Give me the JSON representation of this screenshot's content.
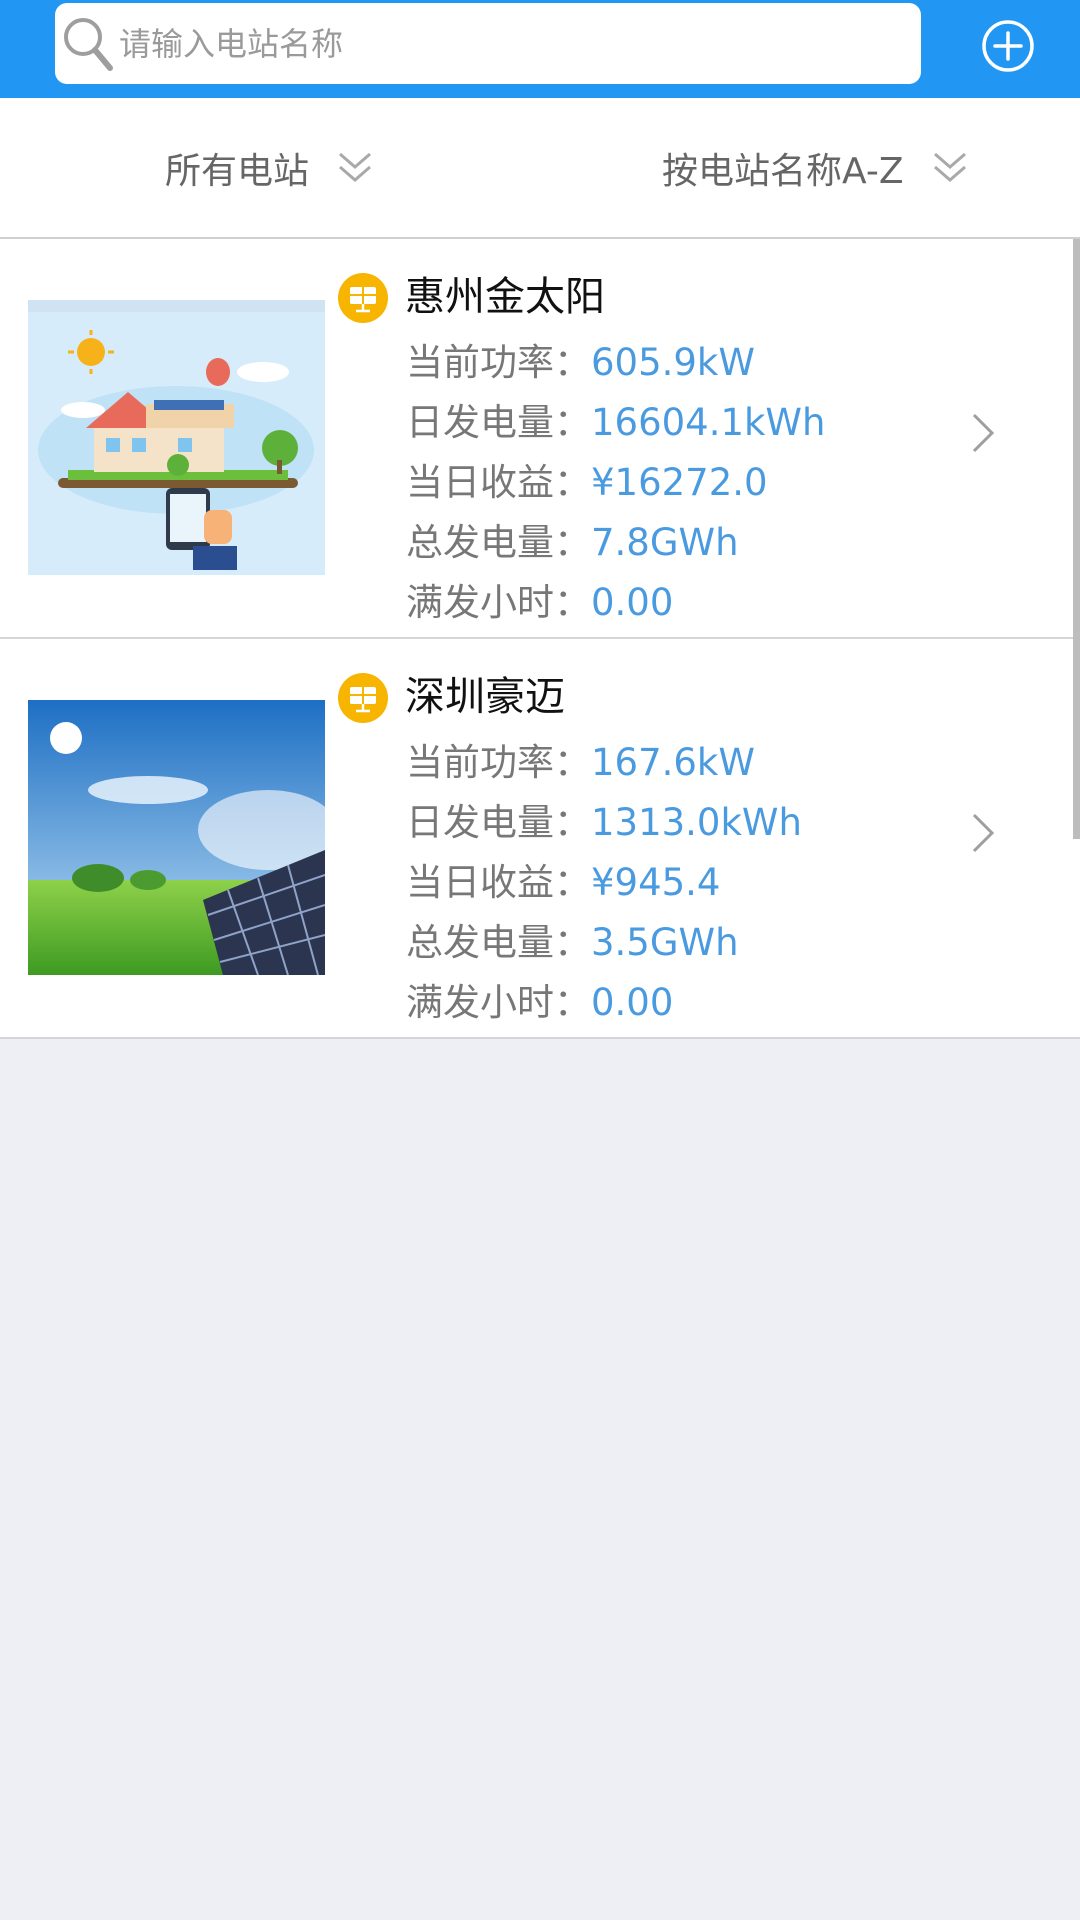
{
  "search": {
    "placeholder": "请输入电站名称"
  },
  "filters": {
    "category": "所有电站",
    "sort": "按电站名称A-Z"
  },
  "stations": [
    {
      "name": "惠州金太阳",
      "metrics": [
        {
          "label": "当前功率：",
          "value": "605.9kW"
        },
        {
          "label": "日发电量：",
          "value": "16604.1kWh"
        },
        {
          "label": "当日收益：",
          "value": "¥16272.0"
        },
        {
          "label": "总发电量：",
          "value": "7.8GWh"
        },
        {
          "label": "满发小时：",
          "value": "0.00"
        }
      ]
    },
    {
      "name": "深圳豪迈",
      "metrics": [
        {
          "label": "当前功率：",
          "value": "167.6kW"
        },
        {
          "label": "日发电量：",
          "value": "1313.0kWh"
        },
        {
          "label": "当日收益：",
          "value": "¥945.4"
        },
        {
          "label": "总发电量：",
          "value": "3.5GWh"
        },
        {
          "label": "满发小时：",
          "value": "0.00"
        }
      ]
    }
  ],
  "colors": {
    "header": "#2196f3",
    "value_text": "#4a9ae0",
    "badge": "#f7b500",
    "background": "#eeeff4"
  },
  "icons": [
    "search-icon",
    "add-circle-icon",
    "double-chevron-down-icon",
    "solar-panel-icon",
    "chevron-right-icon"
  ]
}
